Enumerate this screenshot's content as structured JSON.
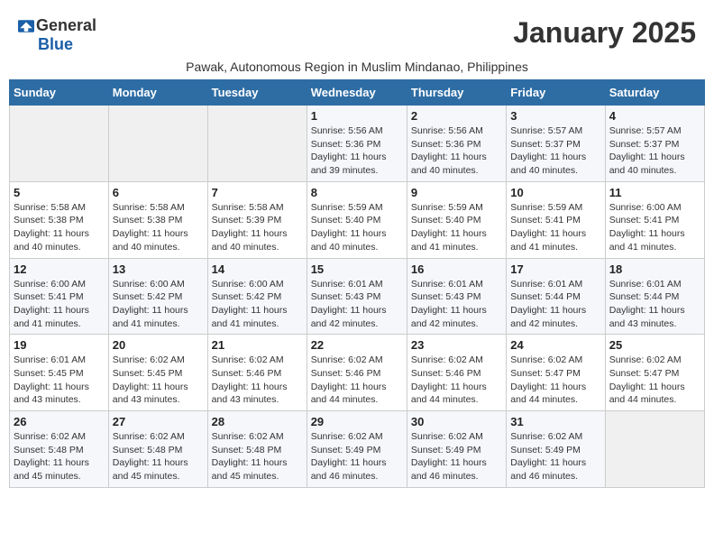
{
  "header": {
    "logo_general": "General",
    "logo_blue": "Blue",
    "month_title": "January 2025",
    "subtitle": "Pawak, Autonomous Region in Muslim Mindanao, Philippines"
  },
  "days_of_week": [
    "Sunday",
    "Monday",
    "Tuesday",
    "Wednesday",
    "Thursday",
    "Friday",
    "Saturday"
  ],
  "weeks": [
    [
      {
        "day": "",
        "info": ""
      },
      {
        "day": "",
        "info": ""
      },
      {
        "day": "",
        "info": ""
      },
      {
        "day": "1",
        "info": "Sunrise: 5:56 AM\nSunset: 5:36 PM\nDaylight: 11 hours and 39 minutes."
      },
      {
        "day": "2",
        "info": "Sunrise: 5:56 AM\nSunset: 5:36 PM\nDaylight: 11 hours and 40 minutes."
      },
      {
        "day": "3",
        "info": "Sunrise: 5:57 AM\nSunset: 5:37 PM\nDaylight: 11 hours and 40 minutes."
      },
      {
        "day": "4",
        "info": "Sunrise: 5:57 AM\nSunset: 5:37 PM\nDaylight: 11 hours and 40 minutes."
      }
    ],
    [
      {
        "day": "5",
        "info": "Sunrise: 5:58 AM\nSunset: 5:38 PM\nDaylight: 11 hours and 40 minutes."
      },
      {
        "day": "6",
        "info": "Sunrise: 5:58 AM\nSunset: 5:38 PM\nDaylight: 11 hours and 40 minutes."
      },
      {
        "day": "7",
        "info": "Sunrise: 5:58 AM\nSunset: 5:39 PM\nDaylight: 11 hours and 40 minutes."
      },
      {
        "day": "8",
        "info": "Sunrise: 5:59 AM\nSunset: 5:40 PM\nDaylight: 11 hours and 40 minutes."
      },
      {
        "day": "9",
        "info": "Sunrise: 5:59 AM\nSunset: 5:40 PM\nDaylight: 11 hours and 41 minutes."
      },
      {
        "day": "10",
        "info": "Sunrise: 5:59 AM\nSunset: 5:41 PM\nDaylight: 11 hours and 41 minutes."
      },
      {
        "day": "11",
        "info": "Sunrise: 6:00 AM\nSunset: 5:41 PM\nDaylight: 11 hours and 41 minutes."
      }
    ],
    [
      {
        "day": "12",
        "info": "Sunrise: 6:00 AM\nSunset: 5:41 PM\nDaylight: 11 hours and 41 minutes."
      },
      {
        "day": "13",
        "info": "Sunrise: 6:00 AM\nSunset: 5:42 PM\nDaylight: 11 hours and 41 minutes."
      },
      {
        "day": "14",
        "info": "Sunrise: 6:00 AM\nSunset: 5:42 PM\nDaylight: 11 hours and 41 minutes."
      },
      {
        "day": "15",
        "info": "Sunrise: 6:01 AM\nSunset: 5:43 PM\nDaylight: 11 hours and 42 minutes."
      },
      {
        "day": "16",
        "info": "Sunrise: 6:01 AM\nSunset: 5:43 PM\nDaylight: 11 hours and 42 minutes."
      },
      {
        "day": "17",
        "info": "Sunrise: 6:01 AM\nSunset: 5:44 PM\nDaylight: 11 hours and 42 minutes."
      },
      {
        "day": "18",
        "info": "Sunrise: 6:01 AM\nSunset: 5:44 PM\nDaylight: 11 hours and 43 minutes."
      }
    ],
    [
      {
        "day": "19",
        "info": "Sunrise: 6:01 AM\nSunset: 5:45 PM\nDaylight: 11 hours and 43 minutes."
      },
      {
        "day": "20",
        "info": "Sunrise: 6:02 AM\nSunset: 5:45 PM\nDaylight: 11 hours and 43 minutes."
      },
      {
        "day": "21",
        "info": "Sunrise: 6:02 AM\nSunset: 5:46 PM\nDaylight: 11 hours and 43 minutes."
      },
      {
        "day": "22",
        "info": "Sunrise: 6:02 AM\nSunset: 5:46 PM\nDaylight: 11 hours and 44 minutes."
      },
      {
        "day": "23",
        "info": "Sunrise: 6:02 AM\nSunset: 5:46 PM\nDaylight: 11 hours and 44 minutes."
      },
      {
        "day": "24",
        "info": "Sunrise: 6:02 AM\nSunset: 5:47 PM\nDaylight: 11 hours and 44 minutes."
      },
      {
        "day": "25",
        "info": "Sunrise: 6:02 AM\nSunset: 5:47 PM\nDaylight: 11 hours and 44 minutes."
      }
    ],
    [
      {
        "day": "26",
        "info": "Sunrise: 6:02 AM\nSunset: 5:48 PM\nDaylight: 11 hours and 45 minutes."
      },
      {
        "day": "27",
        "info": "Sunrise: 6:02 AM\nSunset: 5:48 PM\nDaylight: 11 hours and 45 minutes."
      },
      {
        "day": "28",
        "info": "Sunrise: 6:02 AM\nSunset: 5:48 PM\nDaylight: 11 hours and 45 minutes."
      },
      {
        "day": "29",
        "info": "Sunrise: 6:02 AM\nSunset: 5:49 PM\nDaylight: 11 hours and 46 minutes."
      },
      {
        "day": "30",
        "info": "Sunrise: 6:02 AM\nSunset: 5:49 PM\nDaylight: 11 hours and 46 minutes."
      },
      {
        "day": "31",
        "info": "Sunrise: 6:02 AM\nSunset: 5:49 PM\nDaylight: 11 hours and 46 minutes."
      },
      {
        "day": "",
        "info": ""
      }
    ]
  ]
}
